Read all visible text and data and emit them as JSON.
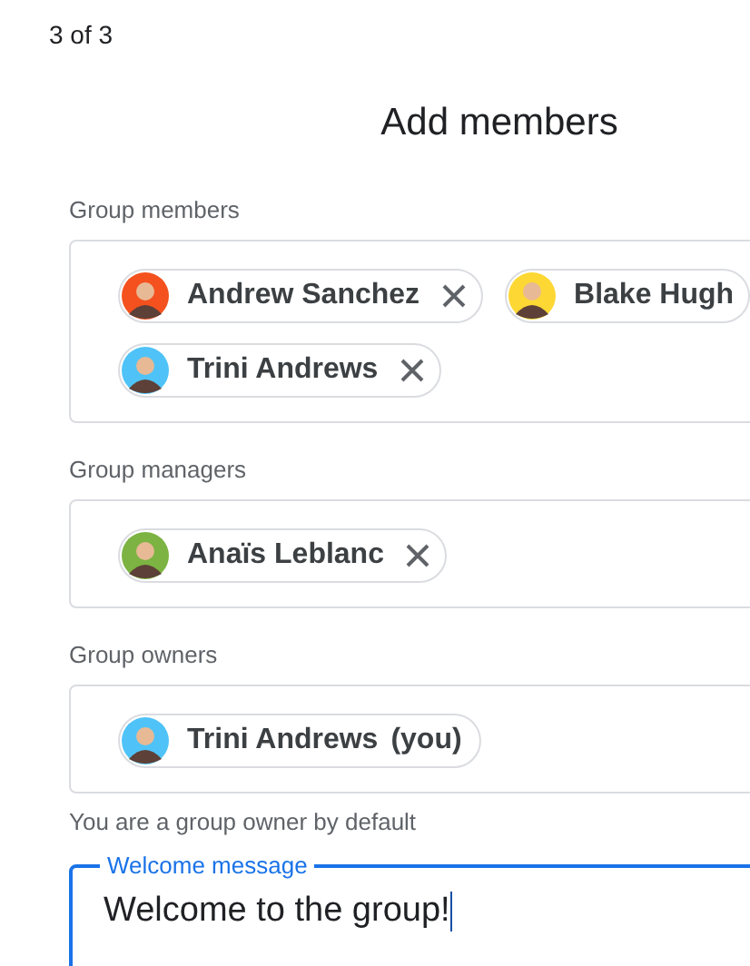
{
  "step": "3 of 3",
  "title": "Add members",
  "sections": [
    {
      "label": "Group members",
      "chips": [
        {
          "name": "Andrew Sanchez",
          "color": "#f4511e",
          "removable": true
        },
        {
          "name": "Blake Hugh",
          "color": "#fdd835"
        },
        {
          "name": "Trini Andrews",
          "color": "#4fc3f7",
          "removable": true
        }
      ]
    },
    {
      "label": "Group managers",
      "chips": [
        {
          "name": "Anaïs Leblanc",
          "color": "#7cb342",
          "removable": true
        }
      ]
    },
    {
      "label": "Group owners",
      "chips": [
        {
          "name": "Trini Andrews",
          "suffix": "(you)",
          "color": "#4fc3f7",
          "removable": false
        }
      ],
      "helper": "You are a group owner by default"
    }
  ],
  "welcome": {
    "label": "Welcome message",
    "value": "Welcome to the group!",
    "focused": true
  }
}
